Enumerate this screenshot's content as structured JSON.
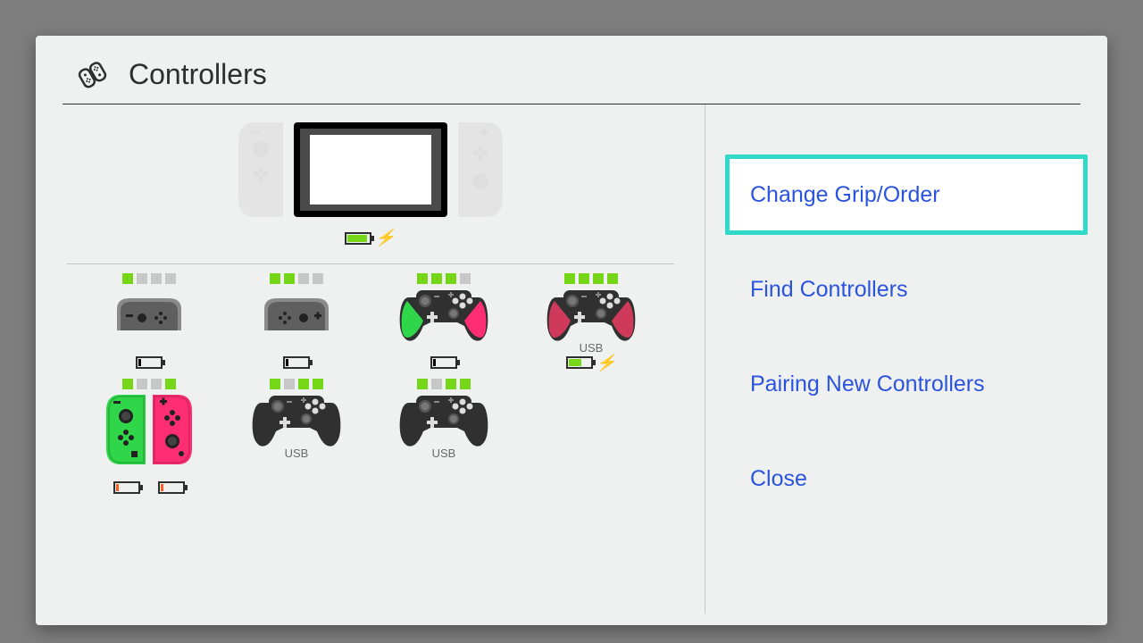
{
  "title": "Controllers",
  "colors": {
    "led_on": "#76d618",
    "accent": "#30d9c8",
    "link": "#2b54de",
    "batt_red": "#ff5a1f",
    "batt_green": "#76d618",
    "neon_green": "#2fd64a",
    "neon_pink": "#ff2e74"
  },
  "console": {
    "battery_level": 85,
    "battery_color": "batt_green",
    "charging": true
  },
  "controllers": [
    {
      "type": "joycon-flat",
      "minus": true,
      "leds": [
        1,
        0,
        0,
        0
      ],
      "usb": "",
      "battery": [
        {
          "level": 10,
          "color": "#000"
        }
      ]
    },
    {
      "type": "joycon-flat",
      "minus": false,
      "leds": [
        1,
        1,
        0,
        0
      ],
      "usb": "",
      "battery": [
        {
          "level": 10,
          "color": "#000"
        }
      ]
    },
    {
      "type": "pro",
      "grip_left": "#2fd64a",
      "grip_right": "#ff2e74",
      "leds": [
        1,
        1,
        1,
        0
      ],
      "usb": "",
      "battery": [
        {
          "level": 10,
          "color": "#000"
        }
      ]
    },
    {
      "type": "pro",
      "grip_left": "#cf3a5b",
      "grip_right": "#cf3a5b",
      "leds": [
        1,
        1,
        1,
        1
      ],
      "usb": "USB",
      "battery": [
        {
          "level": 55,
          "color": "#76d618",
          "charging": true
        }
      ]
    },
    {
      "type": "joycon-pair",
      "left_color": "#2fd64a",
      "right_color": "#ff2e74",
      "leds": [
        1,
        0,
        0,
        1
      ],
      "usb": "",
      "battery": [
        {
          "level": 12,
          "color": "#ff5a1f"
        },
        {
          "level": 12,
          "color": "#ff5a1f"
        }
      ]
    },
    {
      "type": "pro",
      "grip_left": "#303030",
      "grip_right": "#303030",
      "leds": [
        1,
        0,
        1,
        1
      ],
      "usb": "USB",
      "battery": []
    },
    {
      "type": "pro",
      "grip_left": "#303030",
      "grip_right": "#303030",
      "leds": [
        1,
        0,
        1,
        1
      ],
      "usb": "USB",
      "battery": []
    }
  ],
  "menu": [
    {
      "label": "Change Grip/Order",
      "selected": true
    },
    {
      "label": "Find Controllers",
      "selected": false
    },
    {
      "label": "Pairing New Controllers",
      "selected": false
    },
    {
      "label": "Close",
      "selected": false
    }
  ]
}
